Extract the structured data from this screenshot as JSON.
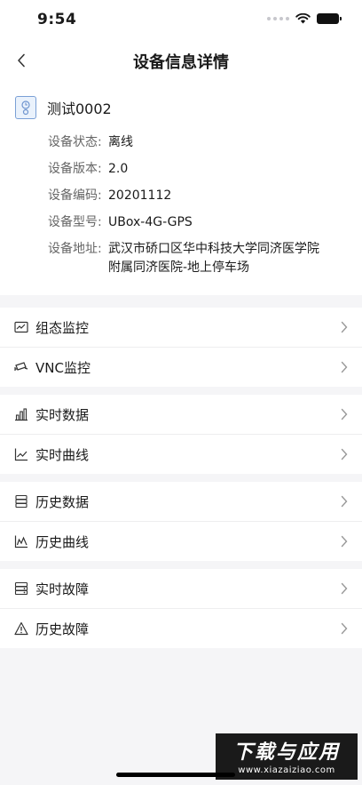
{
  "status_bar": {
    "time": "9:54"
  },
  "nav": {
    "title": "设备信息详情"
  },
  "device": {
    "name": "测试0002",
    "fields": [
      {
        "label": "设备状态:",
        "value": "离线"
      },
      {
        "label": "设备版本:",
        "value": "2.0"
      },
      {
        "label": "设备编码:",
        "value": "20201112"
      },
      {
        "label": "设备型号:",
        "value": "UBox-4G-GPS"
      },
      {
        "label": "设备地址:",
        "value": "武汉市硚口区华中科技大学同济医学院附属同济医院-地上停车场"
      }
    ]
  },
  "menus": {
    "monitor": [
      {
        "label": "组态监控",
        "icon": "monitor-chart-icon"
      },
      {
        "label": "VNC监控",
        "icon": "camera-icon"
      }
    ],
    "realtime": [
      {
        "label": "实时数据",
        "icon": "bar-chart-icon"
      },
      {
        "label": "实时曲线",
        "icon": "line-chart-icon"
      }
    ],
    "history": [
      {
        "label": "历史数据",
        "icon": "database-icon"
      },
      {
        "label": "历史曲线",
        "icon": "area-chart-icon"
      }
    ],
    "faults": [
      {
        "label": "实时故障",
        "icon": "server-icon"
      },
      {
        "label": "历史故障",
        "icon": "warning-icon"
      }
    ]
  },
  "watermark": {
    "title": "下载与应用",
    "url": "www.xiazaiziao.com"
  }
}
